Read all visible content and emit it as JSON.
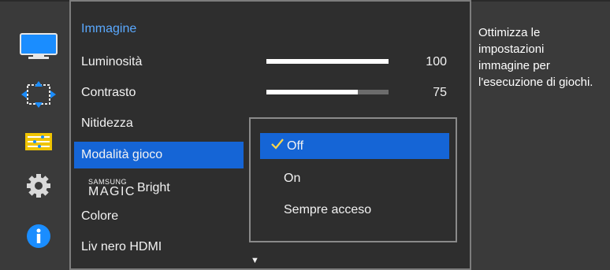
{
  "menu": {
    "title": "Immagine",
    "items": [
      {
        "label": "Luminosità",
        "value": "100",
        "level": 1.0
      },
      {
        "label": "Contrasto",
        "value": "75",
        "level": 0.75
      },
      {
        "label": "Nitidezza"
      },
      {
        "label": "Modalità gioco",
        "selected": true
      },
      {
        "label_top": "SAMSUNG",
        "label_bottom": "MAGIC",
        "label_suffix": "Bright"
      },
      {
        "label": "Colore"
      },
      {
        "label": "Liv nero HDMI"
      }
    ]
  },
  "dropdown": {
    "options": [
      "Off",
      "On",
      "Sempre acceso"
    ],
    "selected": "Off"
  },
  "help": {
    "text": "Ottimizza le impostazioni immagine per l'esecuzione di giochi."
  },
  "rail": {
    "icons": [
      "monitor-icon",
      "position-icon",
      "system-bars-icon",
      "gear-icon",
      "info-icon"
    ]
  },
  "colors": {
    "accent": "#1565d6",
    "title": "#5aa9ff"
  }
}
